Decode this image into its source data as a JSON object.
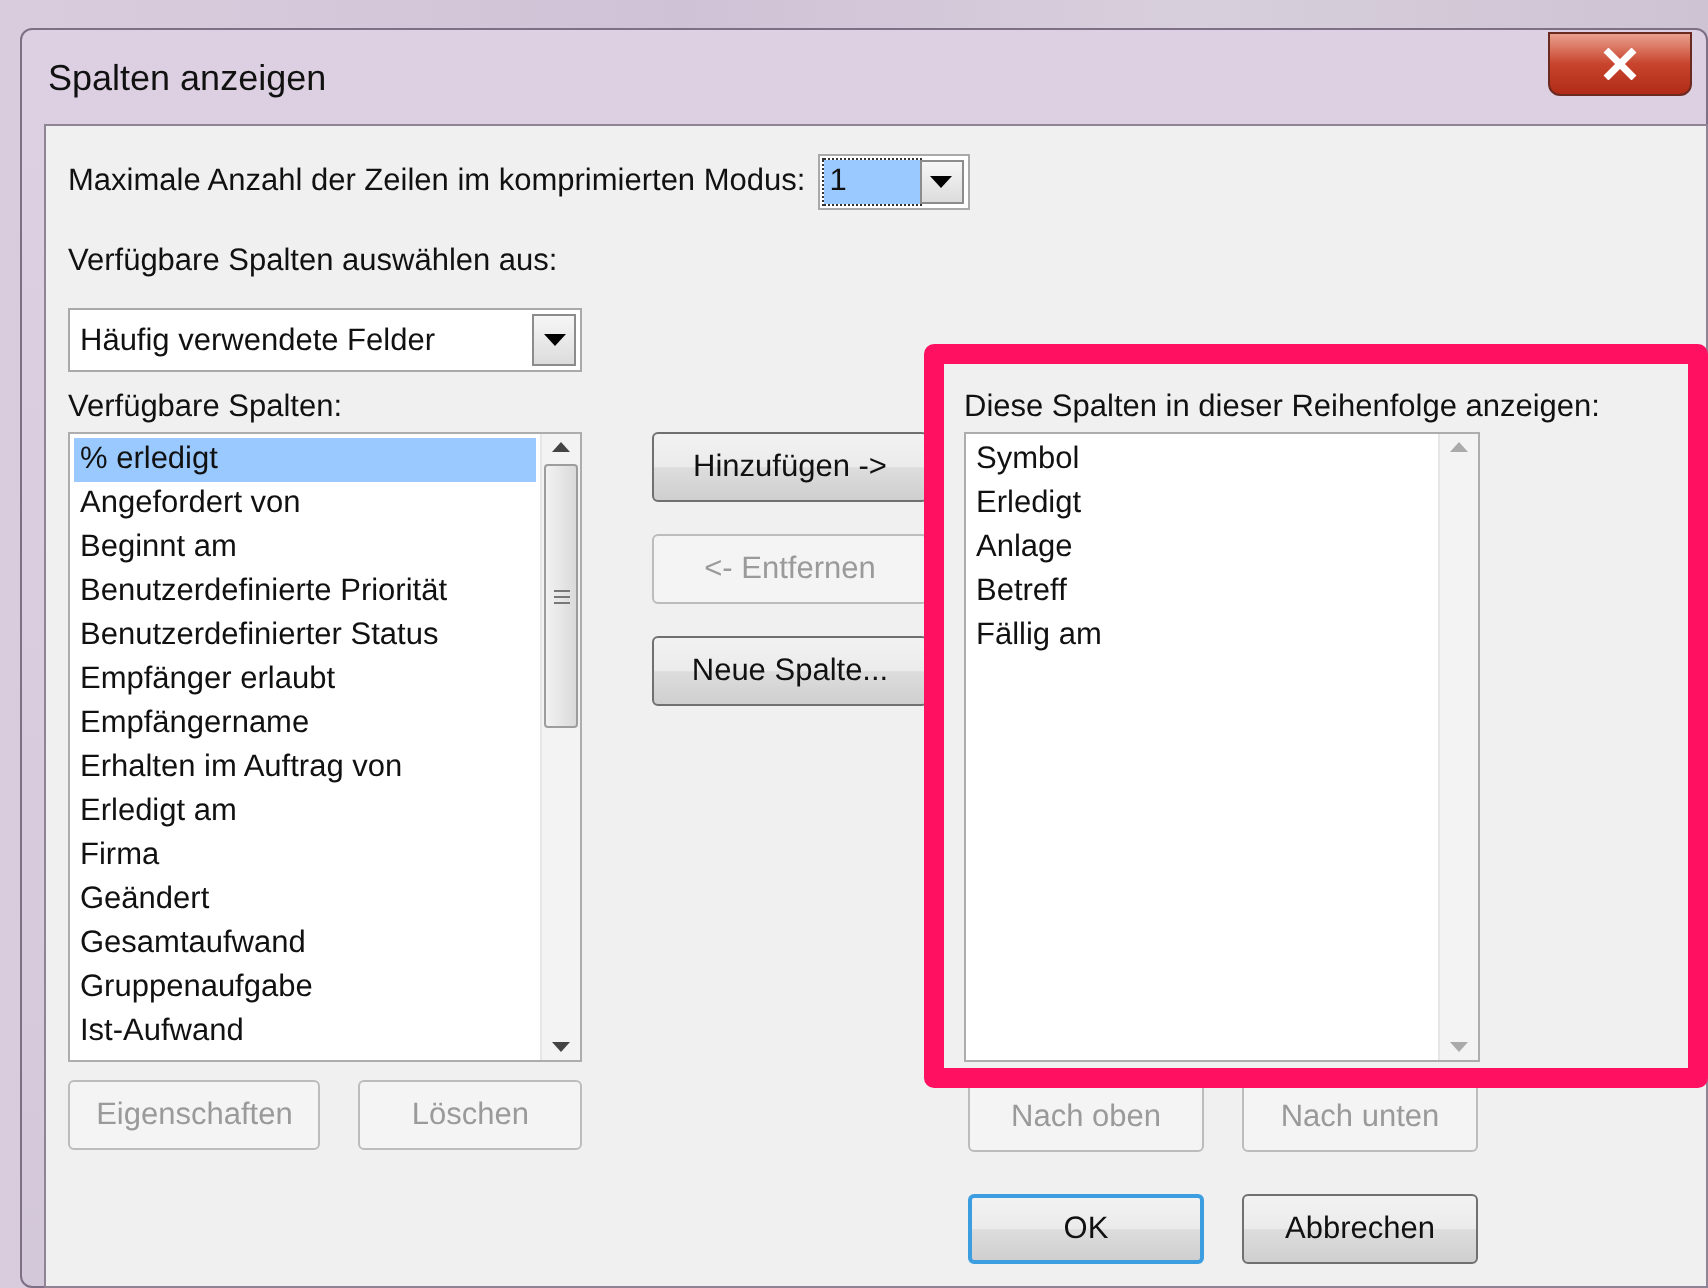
{
  "window": {
    "title": "Spalten anzeigen"
  },
  "max_rows": {
    "label": "Maximale Anzahl der Zeilen im komprimierten Modus:",
    "value": "1"
  },
  "source": {
    "label": "Verfügbare Spalten auswählen aus:",
    "value": "Häufig verwendete Felder"
  },
  "available": {
    "label": "Verfügbare Spalten:",
    "items": [
      {
        "text": "% erledigt",
        "selected": true
      },
      {
        "text": "Angefordert von",
        "selected": false
      },
      {
        "text": "Beginnt am",
        "selected": false
      },
      {
        "text": "Benutzerdefinierte Priorität",
        "selected": false
      },
      {
        "text": "Benutzerdefinierter Status",
        "selected": false
      },
      {
        "text": "Empfänger erlaubt",
        "selected": false
      },
      {
        "text": "Empfängername",
        "selected": false
      },
      {
        "text": "Erhalten im Auftrag von",
        "selected": false
      },
      {
        "text": "Erledigt am",
        "selected": false
      },
      {
        "text": "Firma",
        "selected": false
      },
      {
        "text": "Geändert",
        "selected": false
      },
      {
        "text": "Gesamtaufwand",
        "selected": false
      },
      {
        "text": "Gruppenaufgabe",
        "selected": false
      },
      {
        "text": "Ist-Aufwand",
        "selected": false
      }
    ]
  },
  "available_buttons": [
    {
      "label": "Eigenschaften",
      "disabled": true
    },
    {
      "label": "Löschen",
      "disabled": true
    }
  ],
  "middle_buttons": [
    {
      "label": "Hinzufügen ->",
      "disabled": false
    },
    {
      "label": "<- Entfernen",
      "disabled": true
    },
    {
      "label": "Neue Spalte...",
      "disabled": false
    }
  ],
  "shown": {
    "label": "Diese Spalten in dieser Reihenfolge anzeigen:",
    "items": [
      {
        "text": "Symbol",
        "selected": false
      },
      {
        "text": "Erledigt",
        "selected": false
      },
      {
        "text": "Anlage",
        "selected": false
      },
      {
        "text": "Betreff",
        "selected": false
      },
      {
        "text": "Fällig am",
        "selected": false
      }
    ]
  },
  "order_buttons": [
    {
      "label": "Nach oben",
      "disabled": true
    },
    {
      "label": "Nach unten",
      "disabled": true
    }
  ],
  "dialog_buttons": [
    {
      "label": "OK",
      "default": true
    },
    {
      "label": "Abbrechen",
      "default": false
    }
  ]
}
